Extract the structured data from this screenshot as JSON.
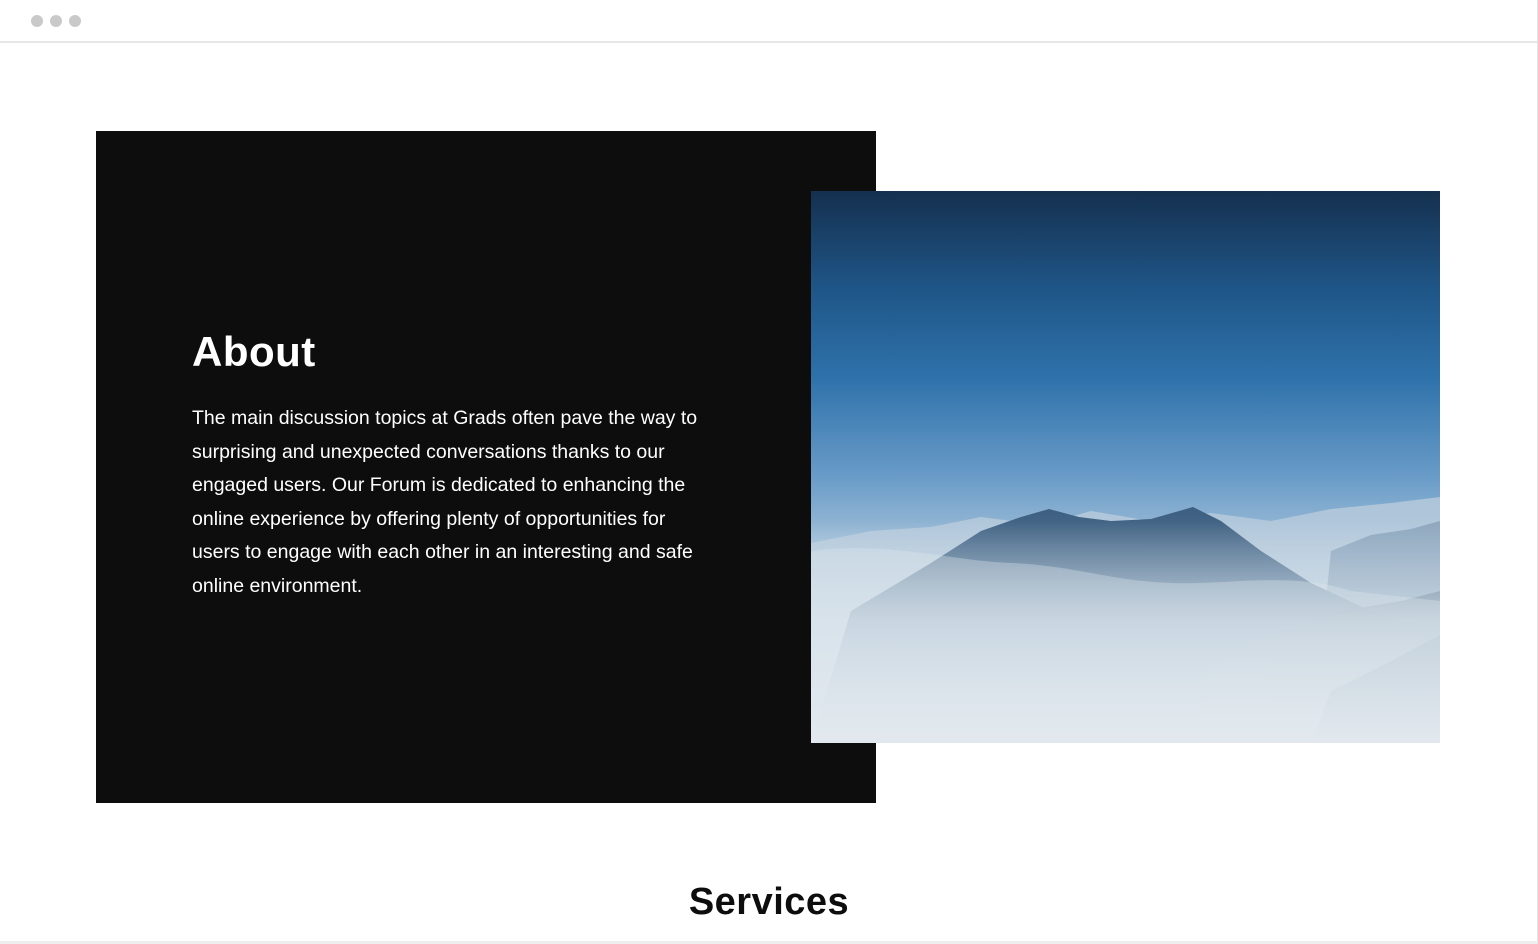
{
  "window": {
    "controls": [
      "window-dot",
      "window-dot",
      "window-dot"
    ]
  },
  "about": {
    "title": "About",
    "body": "The main discussion topics at Grads often pave the way to surprising and unexpected conversations thanks to our engaged users. Our Forum is dedicated to enhancing the online experience by offering plenty of opportunities for users to engage with each other in an interesting and safe online environment.",
    "image_subject": "misty-mountain-peaks-blue-sky"
  },
  "services": {
    "title": "Services"
  },
  "colors": {
    "panel_background": "#0d0d0d",
    "page_background": "#ffffff",
    "text_on_dark": "#ffffff",
    "text_on_light": "#0d0d0d",
    "window_dot": "#c9c9c9"
  }
}
